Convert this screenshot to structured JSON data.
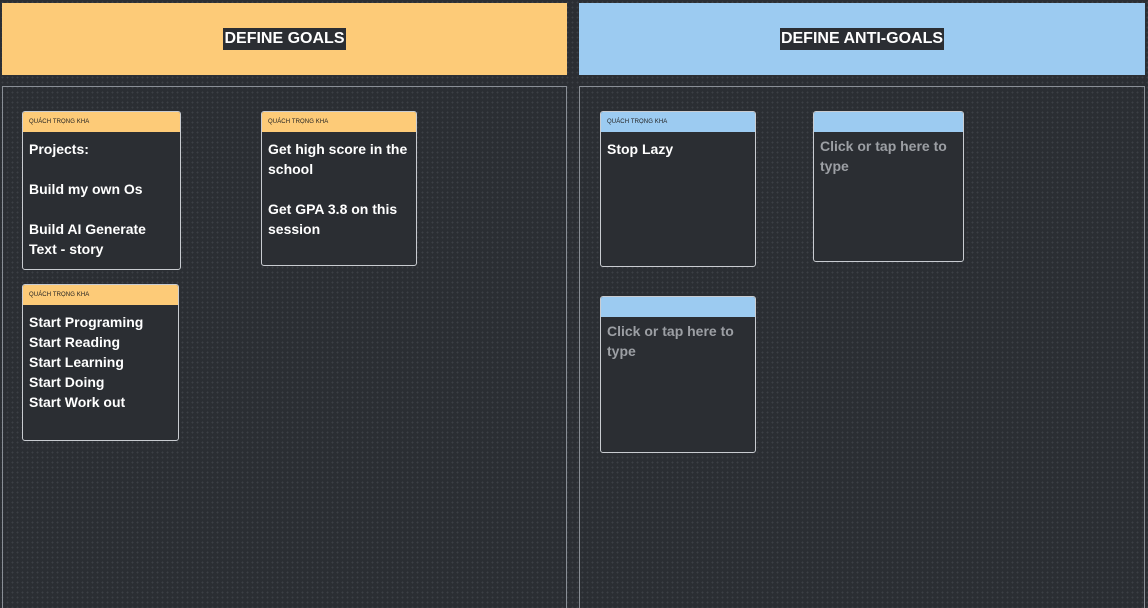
{
  "goals": {
    "title": "DEFINE GOALS",
    "notes": [
      {
        "author": "QUÁCH TRỌNG KHA",
        "lines": [
          "Projects:",
          "",
          "Build my own Os",
          "",
          "Build AI Generate",
          "Text - story"
        ]
      },
      {
        "author": "QUÁCH TRỌNG KHA",
        "lines": [
          "Get high score in the",
          "school",
          "",
          "Get GPA 3.8 on this",
          "session"
        ]
      },
      {
        "author": "QUÁCH TRỌNG KHA",
        "lines": [
          "Start Programing",
          "Start Reading",
          "Start Learning",
          "Start Doing",
          "Start Work out"
        ]
      }
    ]
  },
  "anti_goals": {
    "title": "DEFINE ANTI-GOALS",
    "notes": [
      {
        "author": "QUÁCH TRỌNG KHA",
        "lines": [
          "Stop Lazy"
        ]
      }
    ],
    "placeholder": "Click or tap here to type"
  },
  "colors": {
    "goals_accent": "#fdcb78",
    "anti_goals_accent": "#9ccbf1",
    "board_background": "#2b2e33"
  }
}
